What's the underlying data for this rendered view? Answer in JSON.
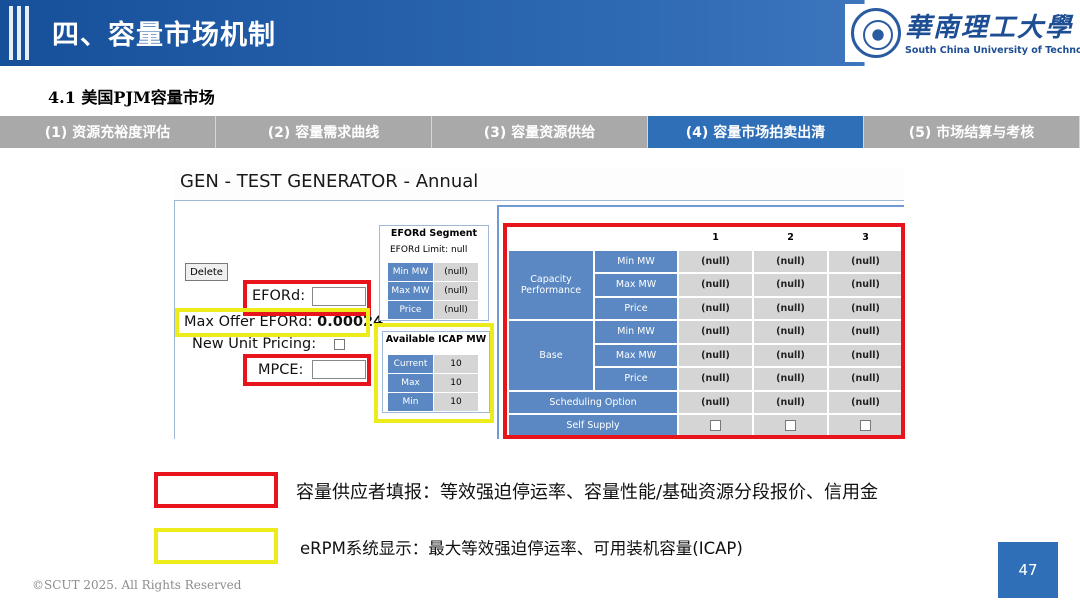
{
  "header": {
    "title": "四、容量市场机制",
    "university_cn": "華南理工大學",
    "university_en": "South China University of Technology"
  },
  "subheading": "4.1 美国PJM容量市场",
  "tabs": [
    {
      "label": "(1) 资源充裕度评估",
      "active": false
    },
    {
      "label": "(2) 容量需求曲线",
      "active": false
    },
    {
      "label": "(3) 容量资源供给",
      "active": false
    },
    {
      "label": "(4) 容量市场拍卖出清",
      "active": true
    },
    {
      "label": "(5) 市场结算与考核",
      "active": false
    }
  ],
  "screen": {
    "title": "GEN - TEST GENERATOR - Annual",
    "delete_label": "Delete",
    "eford_label": "EFORd:",
    "max_offer_label": "Max Offer EFORd:",
    "max_offer_value": "0.00024",
    "new_unit_label": "New Unit Pricing:",
    "mpce_label": "MPCE:",
    "segment": {
      "title": "EFORd Segment",
      "limit_label": "EFORd Limit:",
      "limit_value": "null",
      "rows": [
        {
          "label": "Min MW",
          "value": "(null)"
        },
        {
          "label": "Max MW",
          "value": "(null)"
        },
        {
          "label": "Price",
          "value": "(null)"
        }
      ]
    },
    "icap": {
      "title": "Available ICAP MW",
      "rows": [
        {
          "label": "Current",
          "value": "10"
        },
        {
          "label": "Max",
          "value": "10"
        },
        {
          "label": "Min",
          "value": "10"
        }
      ]
    },
    "grid": {
      "columns": [
        "1",
        "2",
        "3"
      ],
      "group_capacity": "Capacity Performance",
      "group_base": "Base",
      "sub_labels": [
        "Min MW",
        "Max MW",
        "Price"
      ],
      "null_value": "(null)",
      "scheduling_label": "Scheduling Option",
      "self_supply_label": "Self Supply"
    }
  },
  "legend": {
    "red_text": "容量供应者填报：等效强迫停运率、容量性能/基础资源分段报价、信用金",
    "yellow_text": "eRPM系统显示：最大等效强迫停运率、可用装机容量(ICAP)"
  },
  "colors": {
    "red_frame": "#e8141c",
    "yellow_frame": "#ecec1c",
    "accent": "#2f6fb7"
  },
  "footer": {
    "copyright": "©SCUT 2025. All Rights Reserved",
    "page_number": "47"
  }
}
